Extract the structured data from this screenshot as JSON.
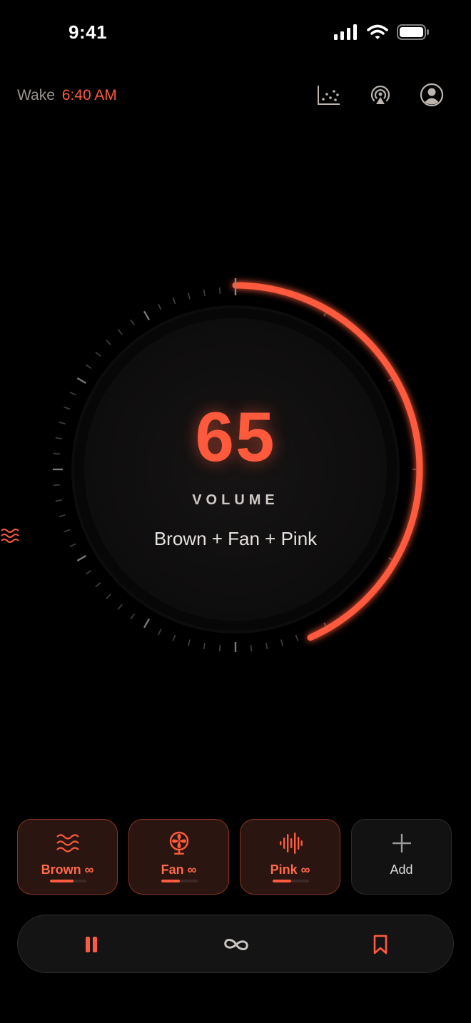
{
  "status": {
    "time": "9:41"
  },
  "header": {
    "wake_label": "Wake",
    "wake_time": "6:40 AM",
    "icons": [
      "stats-icon",
      "airplay-icon",
      "profile-icon"
    ]
  },
  "dial": {
    "value": "65",
    "label": "VOLUME",
    "mix": "Brown + Fan + Pink",
    "level_percent": 65,
    "accent": "#ff5a3c"
  },
  "sounds": [
    {
      "label": "Brown ∞",
      "icon": "waves-icon",
      "level": 0.65
    },
    {
      "label": "Fan ∞",
      "icon": "fan-icon",
      "level": 0.5
    },
    {
      "label": "Pink ∞",
      "icon": "soundwave-icon",
      "level": 0.5
    }
  ],
  "add_tile": {
    "label": "Add",
    "icon": "plus-icon"
  },
  "transport": {
    "icons": [
      "pause-icon",
      "infinity-icon",
      "bookmark-icon"
    ]
  },
  "colors": {
    "accent": "#ff5a3c",
    "background": "#000000",
    "muted": "#9a9490"
  }
}
